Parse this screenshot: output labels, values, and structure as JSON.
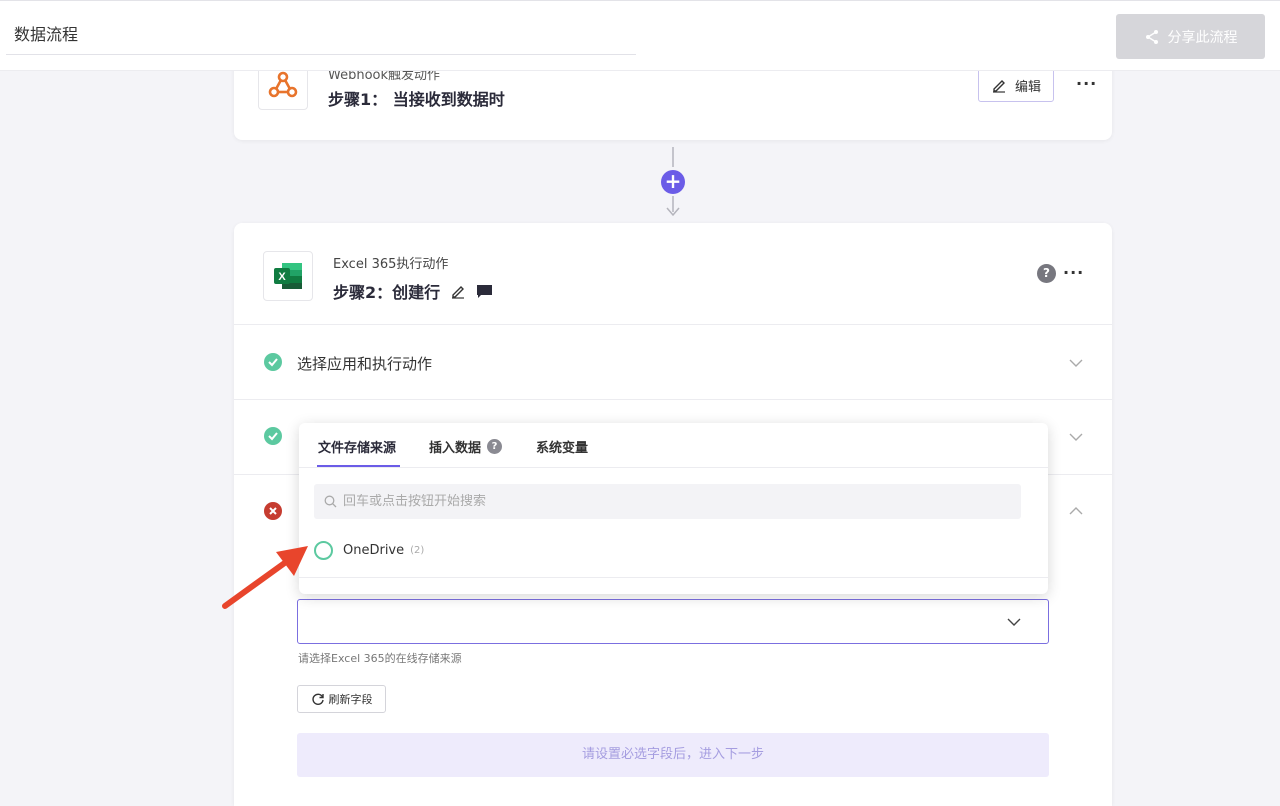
{
  "header": {
    "flow_name": "数据流程",
    "share_label": "分享此流程"
  },
  "step1": {
    "subtitle": "Webhook触发动作",
    "title": "步骤1： 当接收到数据时",
    "edit_label": "编辑",
    "more": "···"
  },
  "step2": {
    "subtitle": "Excel 365执行动作",
    "title": "步骤2：创建行",
    "help": "?",
    "more": "···",
    "sections": [
      {
        "label": "选择应用和执行动作",
        "status": "done"
      },
      {
        "label": "",
        "status": "done"
      },
      {
        "label": "",
        "status": "error"
      }
    ],
    "field_hint": "请选择Excel 365的在线存储来源",
    "refresh_label": "刷新字段",
    "next_label": "请设置必选字段后，进入下一步"
  },
  "popup": {
    "tabs": [
      {
        "label": "文件存储来源",
        "active": true
      },
      {
        "label": "插入数据",
        "help": "?"
      },
      {
        "label": "系统变量"
      }
    ],
    "search_placeholder": "回车或点击按钮开始搜索",
    "options": [
      {
        "label": "OneDrive",
        "count": "(2)"
      }
    ]
  },
  "colors": {
    "accent": "#6b5ce7",
    "success": "#5cc9a0",
    "error": "#c63c30",
    "annotation": "#e8452c"
  }
}
